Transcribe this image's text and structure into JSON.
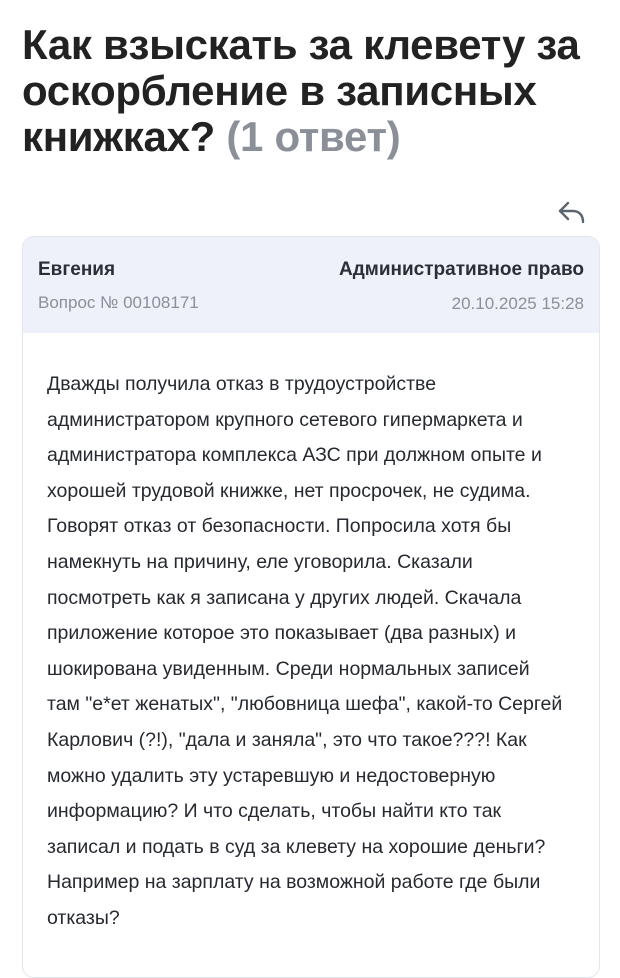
{
  "question": {
    "title": "Как взыскать за клевету за оскорбление в записных книжках?",
    "answers_count": "(1 ответ)",
    "author": "Евгения",
    "category": "Административное право",
    "number": "Вопрос № 00108171",
    "date": "20.10.2025 15:28",
    "text": "Дважды получила отказ в трудоустройстве администратором крупного сетевого гипермаркета и администратора комплекса АЗС при должном опыте и хорошей трудовой книжке, нет просрочек, не судима. Говорят отказ от безопасности. Попросила хотя бы намекнуть на причину, еле уговорила. Сказали посмотреть как я записана у других людей. Скачала приложение которое это показывает (два разных) и шокирована увиденным. Среди нормальных записей там \"е*ет женатых\", \"любовница шефа\", какой-то Сергей Карлович (?!), \"дала и заняла\", это что такое???! Как можно удалить эту устаревшую и недостоверную информацию? И что сделать, чтобы найти кто так записал и подать в суд за клевету на хорошие деньги? Например на зарплату на возможной работе где были отказы?"
  },
  "icons": {
    "share": "share-icon"
  },
  "colors": {
    "title": "#222222",
    "muted": "#8a8f98",
    "card_header_bg": "#eef1f9",
    "card_border": "#e2e6ee"
  }
}
